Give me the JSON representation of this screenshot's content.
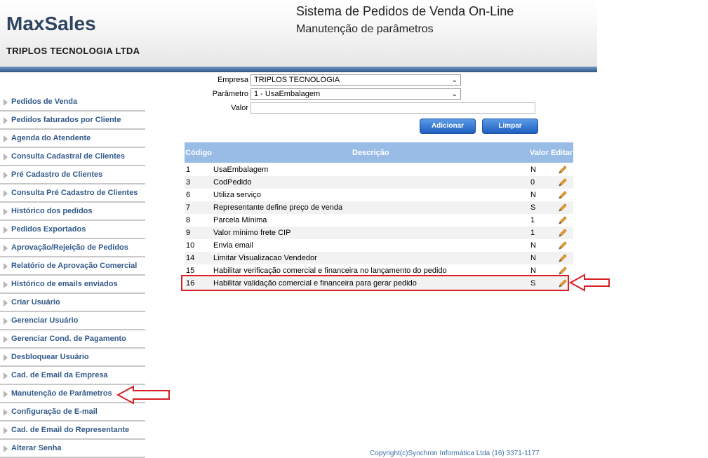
{
  "header": {
    "logo": "MaxSales",
    "company": "TRIPLOS TECNOLOGIA LTDA",
    "title": "Sistema de Pedidos de Venda On-Line",
    "subtitle": "Manutenção de parâmetros"
  },
  "sidebar": {
    "items": [
      {
        "label": "Pedidos de Venda"
      },
      {
        "label": "Pedidos faturados por Cliente"
      },
      {
        "label": "Agenda do Atendente"
      },
      {
        "label": "Consulta Cadastral de Clientes"
      },
      {
        "label": "Pré Cadastro de Clientes"
      },
      {
        "label": "Consulta Pré Cadastro de Clientes"
      },
      {
        "label": "Histórico dos pedidos"
      },
      {
        "label": "Pedidos Exportados"
      },
      {
        "label": "Aprovação/Rejeição de Pedidos"
      },
      {
        "label": "Relatório de Aprovação Comercial"
      },
      {
        "label": "Histórico de emails enviados"
      },
      {
        "label": "Criar Usuário"
      },
      {
        "label": "Gerenciar Usuário"
      },
      {
        "label": "Gerenciar Cond. de Pagamento"
      },
      {
        "label": "Desbloquear Usuário"
      },
      {
        "label": "Cad. de Email da Empresa"
      },
      {
        "label": "Manutenção de Parâmetros"
      },
      {
        "label": "Configuração de E-mail"
      },
      {
        "label": "Cad. de Email do Representante"
      },
      {
        "label": "Alterar Senha"
      }
    ]
  },
  "form": {
    "empresa_label": "Empresa",
    "empresa_value": "TRIPLOS TECNOLOGIA",
    "parametro_label": "Parâmetro",
    "parametro_value": "1 - UsaEmbalagem",
    "valor_label": "Valor",
    "valor_value": "",
    "add_label": "Adicionar",
    "clear_label": "Limpar"
  },
  "table": {
    "headers": {
      "codigo": "Código",
      "descricao": "Descrição",
      "valor": "Valor",
      "editar": "Editar"
    },
    "rows": [
      {
        "codigo": "1",
        "descricao": "UsaEmbalagem",
        "valor": "N"
      },
      {
        "codigo": "3",
        "descricao": "CodPedido",
        "valor": "0"
      },
      {
        "codigo": "6",
        "descricao": "Utiliza serviço",
        "valor": "N"
      },
      {
        "codigo": "7",
        "descricao": "Representante define preço de venda",
        "valor": "S"
      },
      {
        "codigo": "8",
        "descricao": "Parcela Mínima",
        "valor": "1"
      },
      {
        "codigo": "9",
        "descricao": "Valor mínimo frete CIP",
        "valor": "1"
      },
      {
        "codigo": "10",
        "descricao": "Envia email",
        "valor": "N"
      },
      {
        "codigo": "14",
        "descricao": "Limitar Visualizacao Vendedor",
        "valor": "N"
      },
      {
        "codigo": "15",
        "descricao": "Habilitar verificação comercial e financeira no lançamento do pedido",
        "valor": "N"
      },
      {
        "codigo": "16",
        "descricao": "Habilitar validação comercial e financeira para gerar pedido",
        "valor": "S"
      }
    ]
  },
  "footer": "Copyright(c)Synchron Informática Ltda (16) 3371-1177",
  "colors": {
    "accent": "#98bce6",
    "highlight": "#d81f26",
    "link": "#335a8a"
  }
}
